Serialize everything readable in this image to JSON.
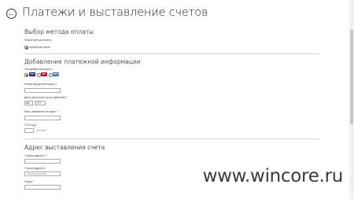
{
  "header": {
    "back_icon": "←",
    "title": "Платежи и выставление счетов"
  },
  "payment_method": {
    "heading": "Выбор метода оплаты",
    "sub_label": "Новый метод оплаты",
    "option_label": "Кредитная карта"
  },
  "payment_info": {
    "heading": "Добавление платежной информации",
    "card_type_label": "Тип кредитной карты *",
    "cards": [
      {
        "name": "VISA",
        "color": "#1a1f71"
      },
      {
        "name": "MC",
        "color": "#c8102e"
      },
      {
        "name": "AMEX",
        "color": "#2e77bb"
      }
    ],
    "card_number_label": "Номер кредитной карты *",
    "card_number_value": "",
    "expiry_label": "Дата окончания срока действия *",
    "expiry_month": "мм",
    "expiry_year": "ГГГГ",
    "name_label": "Имя, указанное на карте *",
    "name_value": "",
    "cvv_label": "CVV-код *",
    "cvv_value": "",
    "cvv_link": "Что это?"
  },
  "billing": {
    "heading": "Адрес выставления счета",
    "line1_label": "Строка адреса 1 *",
    "line1_value": "",
    "line2_label": "Строка адреса 2",
    "line2_placeholder": "Необязательный",
    "city_label": "Город *",
    "city_value": ""
  },
  "watermark": "www.wincore.ru"
}
